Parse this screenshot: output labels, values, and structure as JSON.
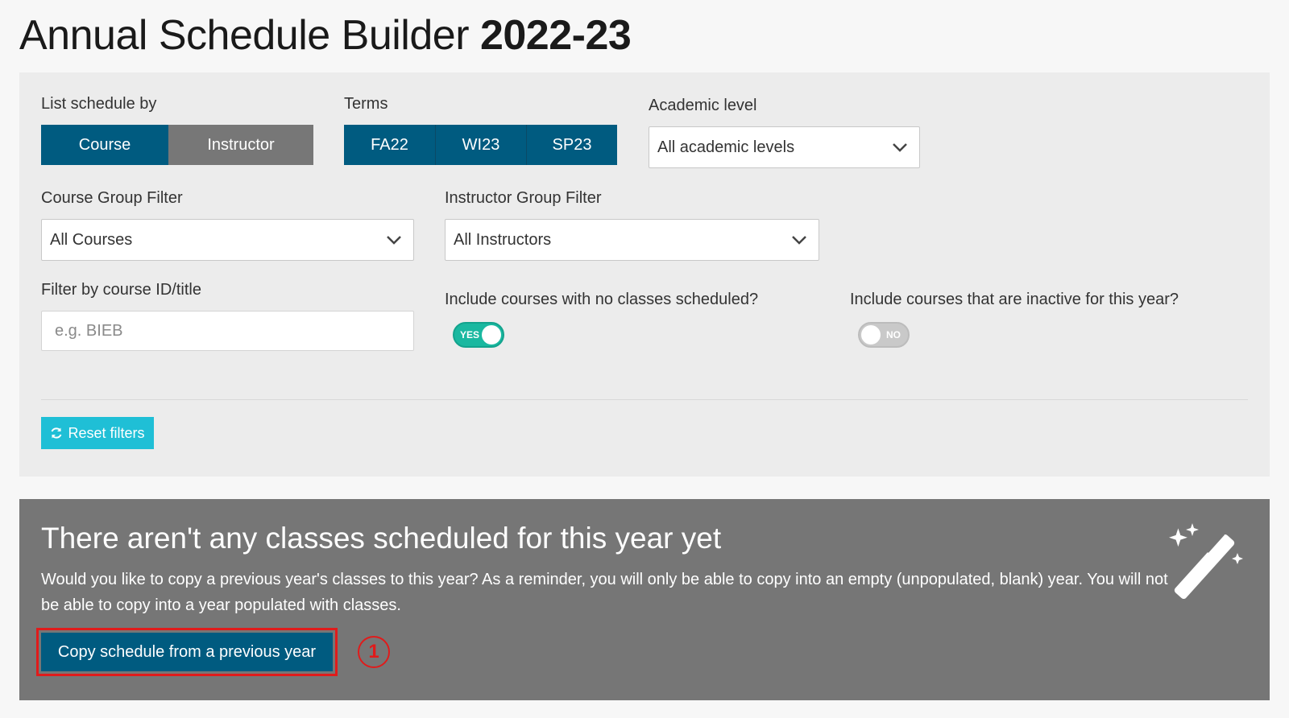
{
  "page": {
    "title_prefix": "Annual Schedule Builder",
    "title_year": "2022-23"
  },
  "filters": {
    "list_by": {
      "label": "List schedule by",
      "options": [
        "Course",
        "Instructor"
      ],
      "selected": "Course"
    },
    "terms": {
      "label": "Terms",
      "options": [
        "FA22",
        "WI23",
        "SP23"
      ]
    },
    "academic_level": {
      "label": "Academic level",
      "value": "All academic levels"
    },
    "course_group": {
      "label": "Course Group Filter",
      "value": "All Courses"
    },
    "instructor_group": {
      "label": "Instructor Group Filter",
      "value": "All Instructors"
    },
    "course_id": {
      "label": "Filter by course ID/title",
      "placeholder": "e.g. BIEB"
    },
    "include_no_classes": {
      "label": "Include courses with no classes scheduled?",
      "state": "YES"
    },
    "include_inactive": {
      "label": "Include courses that are inactive for this year?",
      "state": "NO"
    },
    "reset_label": "Reset filters"
  },
  "notice": {
    "title": "There aren't any classes scheduled for this year yet",
    "body": "Would you like to copy a previous year's classes to this year? As a reminder, you will only be able to copy into an empty (unpopulated, blank) year. You will not be able to copy into a year populated with classes.",
    "copy_button": "Copy schedule from a previous year",
    "step_marker": "1"
  },
  "colors": {
    "primary": "#005b80",
    "toggle_on": "#1ab8a0",
    "reset": "#1fbfd6",
    "highlight": "#e01b1b"
  }
}
